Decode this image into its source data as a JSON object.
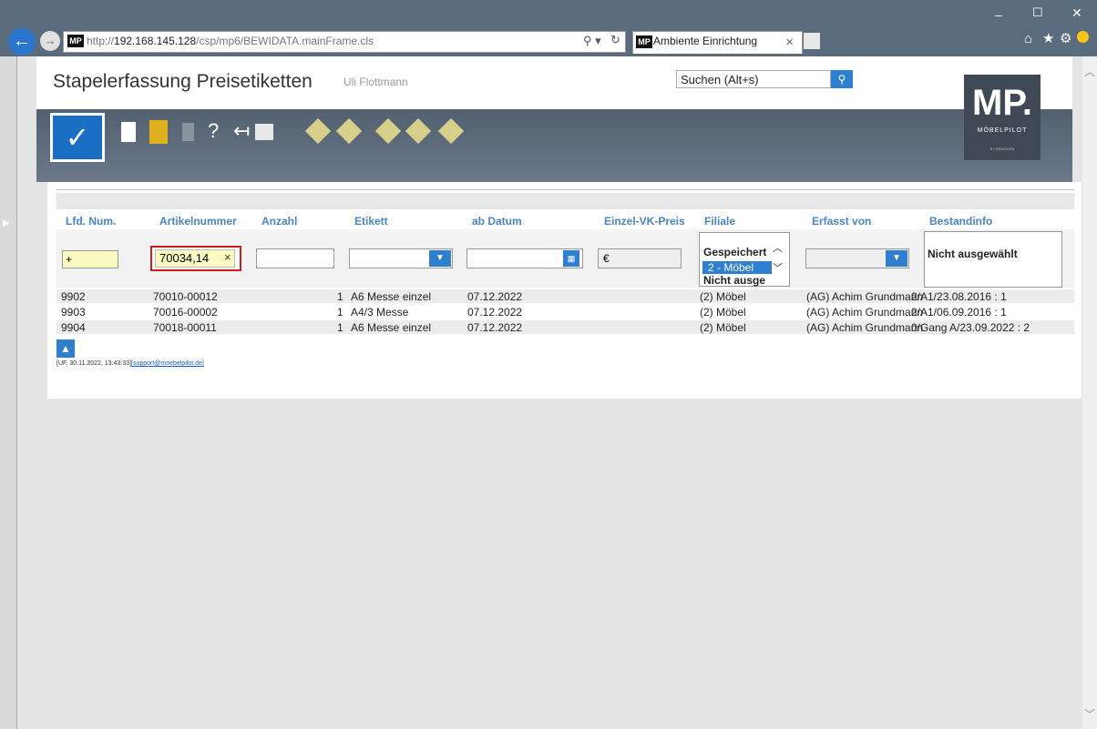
{
  "browser": {
    "url_prefix": "http://",
    "url_host": "192.168.145.128",
    "url_path": "/csp/mp6/BEWIDATA.mainFrame.cls",
    "tab_title": "Ambiente Einrichtung",
    "badge": "MP",
    "window_min": "–",
    "window_max": "☐",
    "window_close": "✕"
  },
  "header": {
    "title": "Stapelerfassung Preisetiketten",
    "user": "Uli Flottmann",
    "search_placeholder": "Suchen (Alt+s)",
    "logo_main": "MP.",
    "logo_sub": "MÖBELPILOT",
    "logo_tiny": "BY BEWIDATA"
  },
  "toolbar": {
    "ok_symbol": "✓",
    "help_symbol": "?",
    "back_symbol": "↤"
  },
  "table": {
    "headers": [
      "Lfd. Num.",
      "Artikelnummer",
      "Anzahl",
      "Etikett",
      "ab Datum",
      "Einzel-VK-Preis",
      "Filiale",
      "Erfasst von",
      "Bestandinfo"
    ],
    "new_row": {
      "lfd": "+",
      "artikel": "70034,14",
      "clear": "×",
      "anzahl": "",
      "etikett": "",
      "datum": "",
      "currency": "€",
      "filiale_options": [
        "Gespeichert",
        "2 - Möbel",
        "Nicht ausge"
      ],
      "erfasst": "",
      "bestand": "Nicht ausgewählt"
    },
    "rows": [
      {
        "lfd": "9902",
        "artikel": "70010-00012",
        "anzahl": "1",
        "etikett": "A6 Messe einzel",
        "datum": "07.12.2022",
        "preis": "",
        "filiale": "(2) Möbel",
        "erfasst": "(AG) Achim Grundmann",
        "bestand": "2/A1/23.08.2016 : 1"
      },
      {
        "lfd": "9903",
        "artikel": "70016-00002",
        "anzahl": "1",
        "etikett": "A4/3 Messe",
        "datum": "07.12.2022",
        "preis": "",
        "filiale": "(2) Möbel",
        "erfasst": "(AG) Achim Grundmann",
        "bestand": "2/A1/06.09.2016 : 1"
      },
      {
        "lfd": "9904",
        "artikel": "70018-00011",
        "anzahl": "1",
        "etikett": "A6 Messe einzel",
        "datum": "07.12.2022",
        "preis": "",
        "filiale": "(2) Möbel",
        "erfasst": "(AG) Achim Grundmann",
        "bestand": "0/Gang A/23.09.2022 : 2"
      }
    ]
  },
  "footer": {
    "text": "[UF, 30.11.2022, 13:43:33]",
    "link": "[support@moebelpilot.de]"
  },
  "colors": {
    "accent": "#2f7fd0",
    "header_text": "#4a86c5",
    "focus_border": "#cc1f1f",
    "input_yellow": "#fafac0"
  }
}
